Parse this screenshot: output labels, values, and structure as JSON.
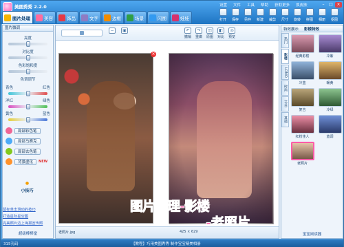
{
  "app": {
    "title": "美图秀秀 2.2.0"
  },
  "menu": [
    "设置",
    "文件",
    "工具",
    "帮助",
    "获取更多",
    "换皮肤"
  ],
  "tabs": [
    {
      "label": "图片处理",
      "color": "#f5b400"
    },
    {
      "label": "美容",
      "color": "#ff6b9d"
    },
    {
      "label": "饰品",
      "color": "#e63946"
    },
    {
      "label": "文字",
      "color": "#8e7cc3"
    },
    {
      "label": "边框",
      "color": "#f08c00"
    },
    {
      "label": "场景",
      "color": "#2f9e44"
    },
    {
      "label": "闪图",
      "color": "#339af0"
    },
    {
      "label": "娃娃",
      "color": "#d6336c"
    }
  ],
  "toolbar": [
    "打开",
    "保存",
    "另存",
    "新建",
    "裁剪",
    "尺寸",
    "旋转",
    "拼图",
    "相册",
    "抠图"
  ],
  "left": {
    "header": "图片微调",
    "sliders": [
      {
        "label": "亮度",
        "value": 0.5
      },
      {
        "label": "对比度",
        "value": 0.5
      },
      {
        "label": "色彩饱和度",
        "value": 0.5
      },
      {
        "label": "色调调节",
        "value": null
      }
    ],
    "color_rows": [
      {
        "left": "青色",
        "right": "红色",
        "value": 0.5
      },
      {
        "left": "洋红",
        "right": "绿色",
        "value": 0.5
      },
      {
        "left": "黄色",
        "right": "蓝色",
        "value": 0.5
      }
    ],
    "effects": [
      {
        "label": "局部彩色笔",
        "color": "#f06595"
      },
      {
        "label": "局部马赛克",
        "color": "#4dabf7"
      },
      {
        "label": "局部去色笔",
        "color": "#82c91e"
      },
      {
        "label": "背景虚化",
        "color": "#ff922b",
        "badge": "NEW"
      }
    ],
    "tips_title": "小技巧",
    "tips": [
      "鼠标单击滑动的技巧",
      "打造星际星空图",
      "完美照片边上海报宣传照"
    ],
    "footer": "超级棒棒堂"
  },
  "center": {
    "tools": [
      "撤销",
      "重做",
      "原图",
      "对比",
      "预览"
    ],
    "close": "×",
    "caption_line1": "图片处理-影楼",
    "caption_line2": "-老照片",
    "filename": "老照片.jpg",
    "size": "425 × 629"
  },
  "right": {
    "header_tabs": [
      "特效展示",
      "影楼特效"
    ],
    "vtabs": [
      "热门",
      "影楼",
      "LOMO",
      "时尚",
      "节日",
      "其他"
    ],
    "thumbs": [
      {
        "label": "经典影楼",
        "color": "#d99ab0"
      },
      {
        "label": "冷紫",
        "color": "#a78bd1"
      },
      {
        "label": "冷蓝",
        "color": "#8fb2d8"
      },
      {
        "label": "暖黄",
        "color": "#e0b66a"
      },
      {
        "label": "复古",
        "color": "#b9a57a"
      },
      {
        "label": "冷绿",
        "color": "#8cc48f"
      },
      {
        "label": "红粉佳人",
        "color": "#ec8fa6"
      },
      {
        "label": "蓝调",
        "color": "#6e8fd6"
      },
      {
        "label": "老照片",
        "color": "#e5c4a8",
        "selected": true
      }
    ],
    "footer": "宝宝阅读器"
  },
  "status": {
    "left": "315孔码",
    "center": "【教程】巧用美图秀秀 制作宝宝精美相册"
  }
}
